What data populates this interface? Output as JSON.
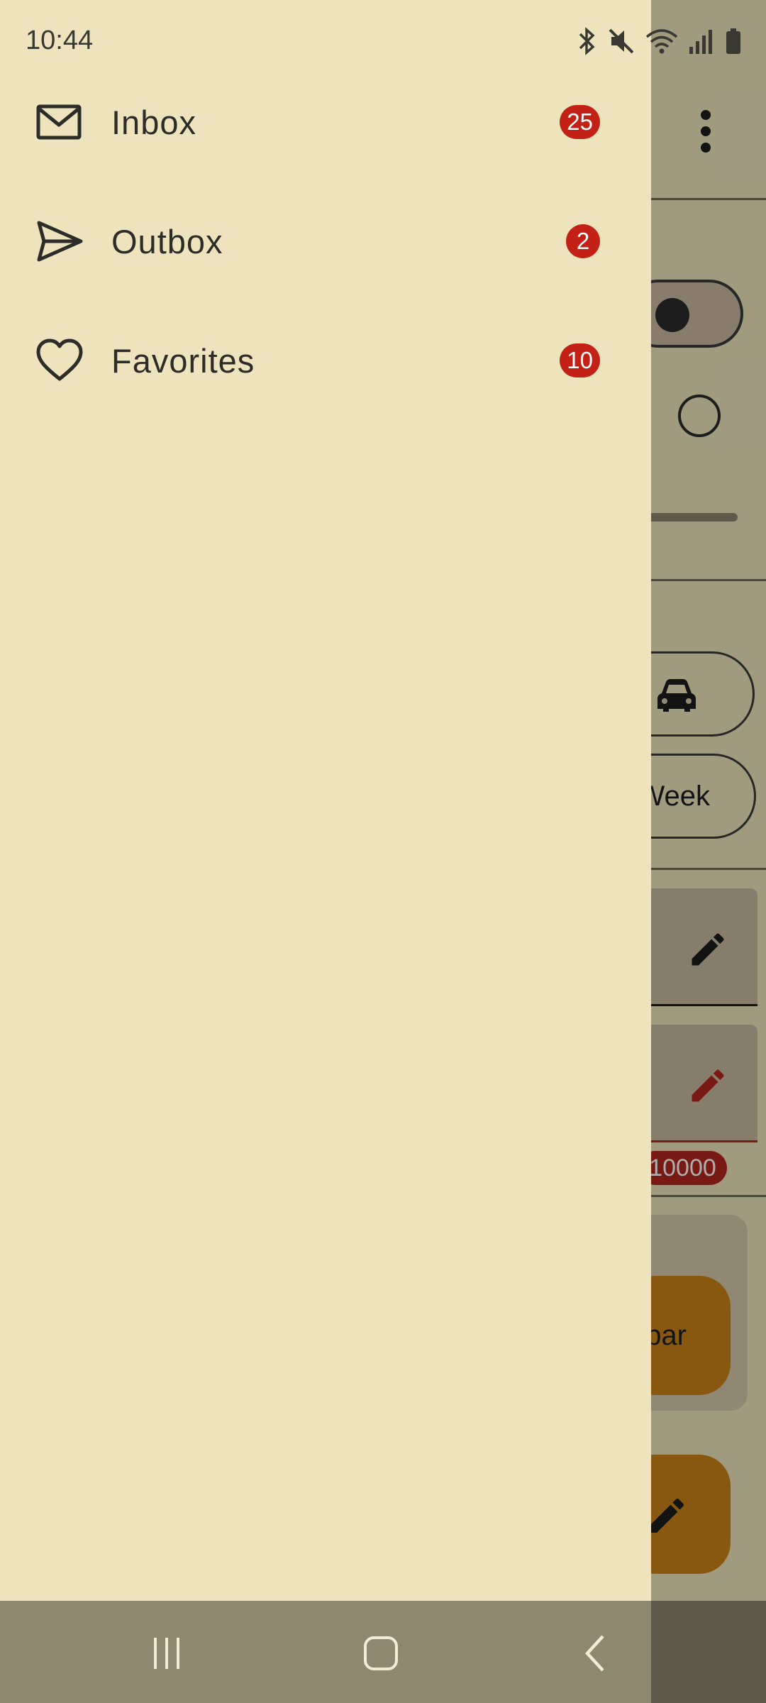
{
  "status_bar": {
    "time": "10:44",
    "icons": [
      "bluetooth-icon",
      "mute-icon",
      "wifi-icon",
      "signal-icon",
      "battery-icon"
    ]
  },
  "drawer": {
    "items": [
      {
        "label": "Inbox",
        "badge": "25",
        "icon": "mail-icon"
      },
      {
        "label": "Outbox",
        "badge": "2",
        "icon": "send-icon"
      },
      {
        "label": "Favorites",
        "badge": "10",
        "icon": "heart-icon"
      }
    ]
  },
  "background": {
    "chip_week_label": "Week",
    "badge_value": "10000",
    "fab_extended_label": "bar"
  },
  "system_nav": {
    "buttons": [
      "recents-icon",
      "home-icon",
      "back-icon"
    ]
  },
  "colors": {
    "drawer_bg": "#ede4be",
    "badge": "#c42116",
    "fab": "#c9821a",
    "nav_bar": "#8f8870"
  }
}
